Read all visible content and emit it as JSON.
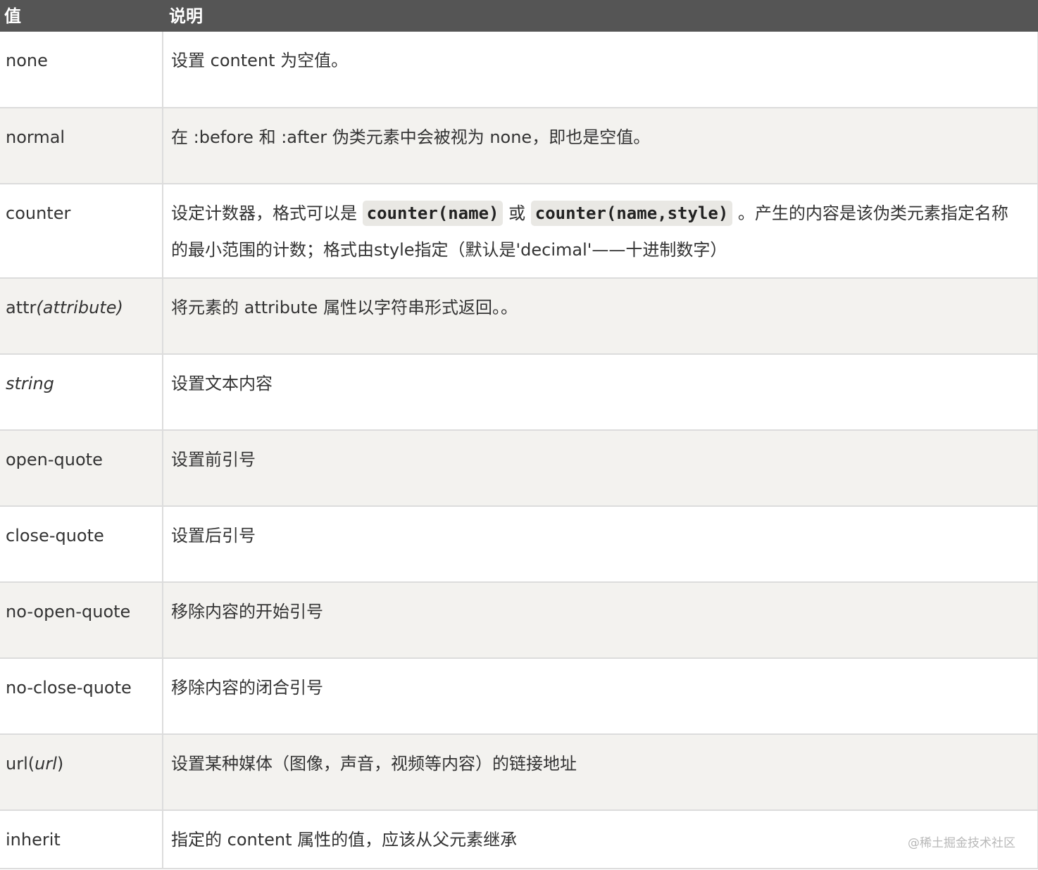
{
  "header": {
    "col_value": "值",
    "col_desc": "说明"
  },
  "rows": [
    {
      "value": "none",
      "desc": "设置 content 为空值。"
    },
    {
      "value": "normal",
      "desc": "在 :before 和 :after 伪类元素中会被视为 none，即也是空值。"
    },
    {
      "value": "counter",
      "desc_prefix": "设定计数器，格式可以是 ",
      "code1": "counter(name)",
      "desc_mid": " 或 ",
      "code2": "counter(name,style)",
      "desc_suffix": " 。产生的内容是该伪类元素指定名称的最小范围的计数；格式由style指定（默认是'decimal'——十进制数字）"
    },
    {
      "value_prefix": "attr",
      "value_italic": "(attribute)",
      "desc": "将元素的 attribute 属性以字符串形式返回。。"
    },
    {
      "value_italic": "string",
      "desc": "设置文本内容"
    },
    {
      "value": "open-quote",
      "desc": "设置前引号"
    },
    {
      "value": "close-quote",
      "desc": "设置后引号"
    },
    {
      "value": "no-open-quote",
      "desc": "移除内容的开始引号"
    },
    {
      "value": "no-close-quote",
      "desc": "移除内容的闭合引号"
    },
    {
      "value_prefix": "url(",
      "value_italic": "url",
      "value_suffix": ")",
      "desc": "设置某种媒体（图像，声音，视频等内容）的链接地址"
    },
    {
      "value": "inherit",
      "desc": "指定的 content 属性的值，应该从父元素继承"
    }
  ],
  "watermark": "@稀土掘金技术社区",
  "colors": {
    "header_bg": "#555555",
    "row_alt_bg": "#f3f2ef",
    "border": "#dcdcdc",
    "text": "#333333",
    "code_bg": "#e9e8e4"
  }
}
